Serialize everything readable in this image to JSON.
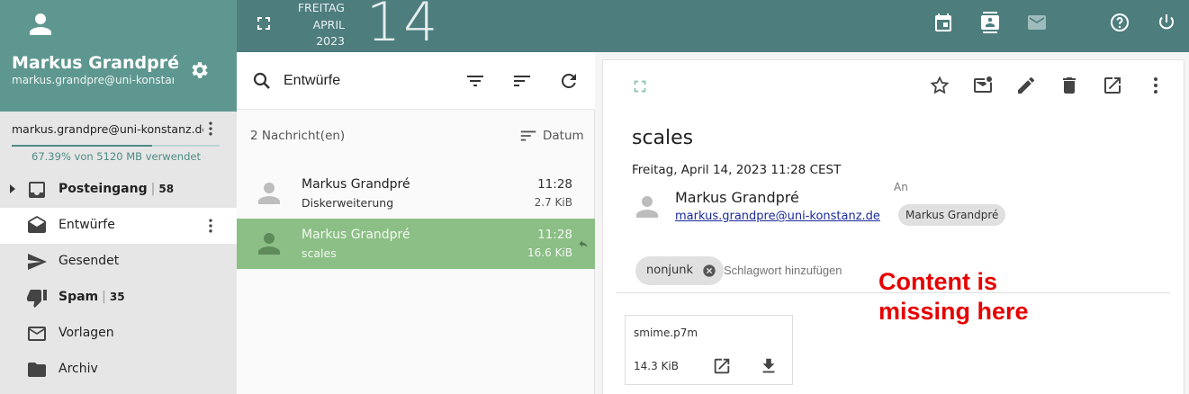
{
  "user": {
    "name": "Markus Grandpré",
    "email": "markus.grandpre@uni-konstanz.de"
  },
  "account": {
    "email": "markus.grandpre@uni-konstanz.de",
    "quota_fraction": 0.6739,
    "quota_text": "67.39% von 5120 MB verwendet"
  },
  "folders": [
    {
      "label": "Posteingang",
      "count": "58",
      "bold": true,
      "icon": "inbox-icon"
    },
    {
      "label": "Entwürfe",
      "count": "",
      "bold": false,
      "icon": "drafts-icon",
      "active": true
    },
    {
      "label": "Gesendet",
      "count": "",
      "bold": false,
      "icon": "send-icon"
    },
    {
      "label": "Spam",
      "count": "35",
      "bold": true,
      "icon": "thumb-down-icon"
    },
    {
      "label": "Vorlagen",
      "count": "",
      "bold": false,
      "icon": "mail-outline-icon"
    },
    {
      "label": "Archiv",
      "count": "",
      "bold": false,
      "icon": "folder-icon"
    }
  ],
  "topbar": {
    "weekday": "FREITAG",
    "month": "APRIL",
    "year": "2023",
    "day": "14",
    "icons": [
      "calendar-icon",
      "contacts-icon",
      "mail-icon",
      "help-icon",
      "power-icon"
    ]
  },
  "list": {
    "search_value": "Entwürfe",
    "count_label": "2 Nachricht(en)",
    "sort_label": "Datum",
    "messages": [
      {
        "sender": "Markus Grandpré",
        "subject": "Diskerweiterung",
        "time": "11:28",
        "size": "2.7 KiB",
        "selected": false
      },
      {
        "sender": "Markus Grandpré",
        "subject": "scales",
        "time": "11:28",
        "size": "16.6 KiB",
        "selected": true
      }
    ]
  },
  "reader": {
    "subject": "scales",
    "date": "Freitag, April 14, 2023 11:28 CEST",
    "from_name": "Markus Grandpré",
    "from_email": "markus.grandpre@uni-konstanz.de",
    "to_label": "An",
    "to_name": "Markus Grandpré",
    "tag": "nonjunk",
    "tag_placeholder": "Schlagwort hinzufügen",
    "missing_note_line1": "Content is",
    "missing_note_line2": "missing here",
    "attachment": {
      "name": "smime.p7m",
      "size": "14.3 KiB"
    }
  },
  "colors": {
    "header": "#5e9790",
    "topbar": "#4e7d7d",
    "selected_row": "#8cbf86",
    "note": "#e60000"
  }
}
